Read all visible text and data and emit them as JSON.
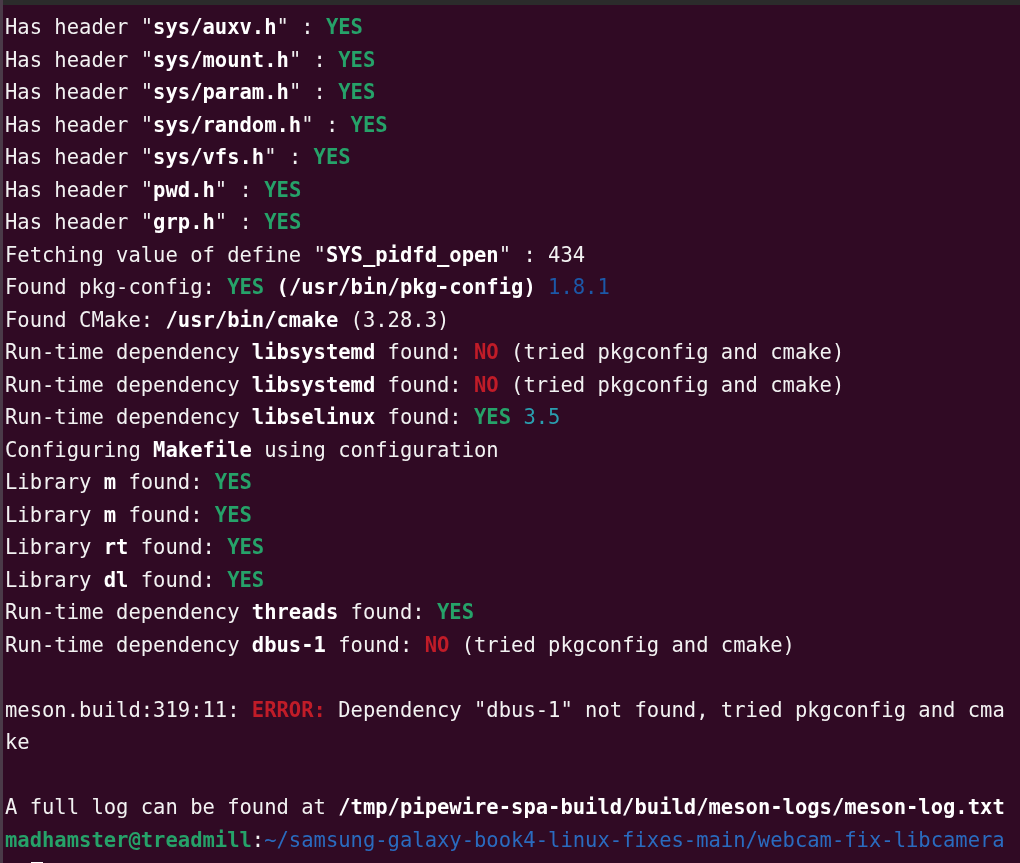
{
  "terminal": {
    "lines": [
      {
        "segments": [
          {
            "text": "Has header \""
          },
          {
            "text": "sys/auxv.h",
            "kind": "bold"
          },
          {
            "text": "\" : "
          },
          {
            "text": "YES",
            "kind": "ok"
          }
        ]
      },
      {
        "segments": [
          {
            "text": "Has header \""
          },
          {
            "text": "sys/mount.h",
            "kind": "bold"
          },
          {
            "text": "\" : "
          },
          {
            "text": "YES",
            "kind": "ok"
          }
        ]
      },
      {
        "segments": [
          {
            "text": "Has header \""
          },
          {
            "text": "sys/param.h",
            "kind": "bold"
          },
          {
            "text": "\" : "
          },
          {
            "text": "YES",
            "kind": "ok"
          }
        ]
      },
      {
        "segments": [
          {
            "text": "Has header \""
          },
          {
            "text": "sys/random.h",
            "kind": "bold"
          },
          {
            "text": "\" : "
          },
          {
            "text": "YES",
            "kind": "ok"
          }
        ]
      },
      {
        "segments": [
          {
            "text": "Has header \""
          },
          {
            "text": "sys/vfs.h",
            "kind": "bold"
          },
          {
            "text": "\" : "
          },
          {
            "text": "YES",
            "kind": "ok"
          }
        ]
      },
      {
        "segments": [
          {
            "text": "Has header \""
          },
          {
            "text": "pwd.h",
            "kind": "bold"
          },
          {
            "text": "\" : "
          },
          {
            "text": "YES",
            "kind": "ok"
          }
        ]
      },
      {
        "segments": [
          {
            "text": "Has header \""
          },
          {
            "text": "grp.h",
            "kind": "bold"
          },
          {
            "text": "\" : "
          },
          {
            "text": "YES",
            "kind": "ok"
          }
        ]
      },
      {
        "segments": [
          {
            "text": "Fetching value of define \""
          },
          {
            "text": "SYS_pidfd_open",
            "kind": "bold"
          },
          {
            "text": "\" : 434"
          }
        ]
      },
      {
        "segments": [
          {
            "text": "Found pkg-config: "
          },
          {
            "text": "YES",
            "kind": "ok"
          },
          {
            "text": " (/usr/bin/pkg-config)",
            "kind": "bold"
          },
          {
            "text": " 1.8.1",
            "kind": "version"
          }
        ]
      },
      {
        "segments": [
          {
            "text": "Found CMake: "
          },
          {
            "text": "/usr/bin/cmake",
            "kind": "bold"
          },
          {
            "text": " (3.28.3)"
          }
        ]
      },
      {
        "segments": [
          {
            "text": "Run-time dependency "
          },
          {
            "text": "libsystemd",
            "kind": "bold"
          },
          {
            "text": " found: "
          },
          {
            "text": "NO",
            "kind": "fail"
          },
          {
            "text": " (tried pkgconfig and cmake)"
          }
        ]
      },
      {
        "segments": [
          {
            "text": "Run-time dependency "
          },
          {
            "text": "libsystemd",
            "kind": "bold"
          },
          {
            "text": " found: "
          },
          {
            "text": "NO",
            "kind": "fail"
          },
          {
            "text": " (tried pkgconfig and cmake)"
          }
        ]
      },
      {
        "segments": [
          {
            "text": "Run-time dependency "
          },
          {
            "text": "libselinux",
            "kind": "bold"
          },
          {
            "text": " found: "
          },
          {
            "text": "YES",
            "kind": "ok"
          },
          {
            "text": " 3.5",
            "kind": "found-version"
          }
        ]
      },
      {
        "segments": [
          {
            "text": "Configuring "
          },
          {
            "text": "Makefile",
            "kind": "bold"
          },
          {
            "text": " using configuration"
          }
        ]
      },
      {
        "segments": [
          {
            "text": "Library "
          },
          {
            "text": "m",
            "kind": "bold"
          },
          {
            "text": " found: "
          },
          {
            "text": "YES",
            "kind": "ok"
          }
        ]
      },
      {
        "segments": [
          {
            "text": "Library "
          },
          {
            "text": "m",
            "kind": "bold"
          },
          {
            "text": " found: "
          },
          {
            "text": "YES",
            "kind": "ok"
          }
        ]
      },
      {
        "segments": [
          {
            "text": "Library "
          },
          {
            "text": "rt",
            "kind": "bold"
          },
          {
            "text": " found: "
          },
          {
            "text": "YES",
            "kind": "ok"
          }
        ]
      },
      {
        "segments": [
          {
            "text": "Library "
          },
          {
            "text": "dl",
            "kind": "bold"
          },
          {
            "text": " found: "
          },
          {
            "text": "YES",
            "kind": "ok"
          }
        ]
      },
      {
        "segments": [
          {
            "text": "Run-time dependency "
          },
          {
            "text": "threads",
            "kind": "bold"
          },
          {
            "text": " found: "
          },
          {
            "text": "YES",
            "kind": "ok"
          }
        ]
      },
      {
        "segments": [
          {
            "text": "Run-time dependency "
          },
          {
            "text": "dbus-1",
            "kind": "bold"
          },
          {
            "text": " found: "
          },
          {
            "text": "NO",
            "kind": "fail"
          },
          {
            "text": " (tried pkgconfig and cmake)"
          }
        ]
      },
      {
        "kind": "blank"
      },
      {
        "segments": [
          {
            "text": "meson.build:319:11: "
          },
          {
            "text": "ERROR:",
            "kind": "error"
          },
          {
            "text": " Dependency \"dbus-1\" not found, tried pkgconfig and cma"
          }
        ]
      },
      {
        "segments": [
          {
            "text": "ke"
          }
        ]
      },
      {
        "kind": "blank"
      },
      {
        "segments": [
          {
            "text": "A full log can be found at "
          },
          {
            "text": "/tmp/pipewire-spa-build/build/meson-logs/meson-log.txt",
            "kind": "bold"
          }
        ]
      },
      {
        "segments": [
          {
            "text": "madhamster@treadmill",
            "kind": "user"
          },
          {
            "text": ":"
          },
          {
            "text": "~/samsung-galaxy-book4-linux-fixes-main/webcam-fix-libcamera",
            "kind": "path"
          }
        ]
      },
      {
        "kind": "cursor"
      }
    ]
  }
}
